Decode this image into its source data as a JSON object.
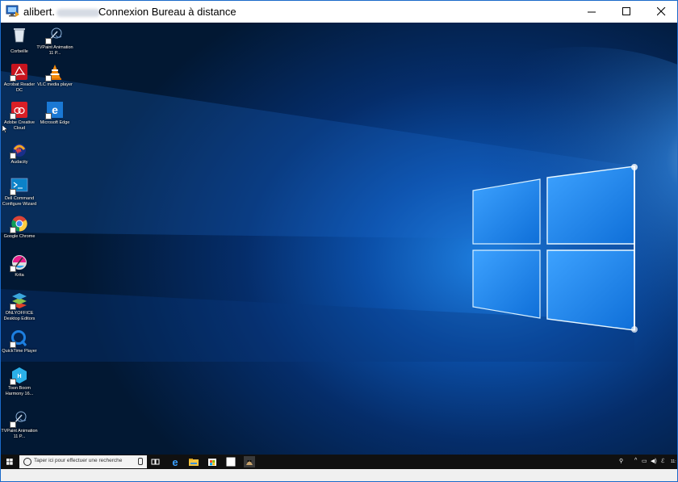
{
  "window": {
    "title_host": "alibert.",
    "title_app": "Connexion Bureau à distance",
    "controls": [
      "minimize",
      "maximize",
      "close"
    ]
  },
  "desktop_icons": [
    {
      "label": "Corbeille",
      "icon": "recycle-bin-icon"
    },
    {
      "label": "TVPaint Animation 11 P...",
      "icon": "tvpaint-icon"
    },
    {
      "label": "Acrobat Reader DC",
      "icon": "acrobat-icon"
    },
    {
      "label": "VLC media player",
      "icon": "vlc-icon"
    },
    {
      "label": "Adobe Creative Cloud",
      "icon": "creative-cloud-icon"
    },
    {
      "label": "Microsoft Edge",
      "icon": "edge-icon"
    },
    {
      "label": "Audacity",
      "icon": "audacity-icon"
    },
    {
      "label": "Dell Command Configure Wizard",
      "icon": "dell-command-icon"
    },
    {
      "label": "Google Chrome",
      "icon": "chrome-icon"
    },
    {
      "label": "Krita",
      "icon": "krita-icon"
    },
    {
      "label": "ONLYOFFICE Desktop Editors",
      "icon": "onlyoffice-icon"
    },
    {
      "label": "QuickTime Player",
      "icon": "quicktime-icon"
    },
    {
      "label": "Toon Boom Harmony 16...",
      "icon": "toonboom-icon"
    },
    {
      "label": "TVPaint Animation 11 P...",
      "icon": "tvpaint-icon"
    }
  ],
  "taskbar": {
    "search_placeholder": "Taper ici pour effectuer une recherche",
    "pinned": [
      "task-view-icon",
      "edge-icon",
      "file-explorer-icon",
      "store-icon",
      "blank-app-icon",
      "gimp-icon"
    ],
    "tray_clock": "11:"
  },
  "colors": {
    "accent": "#1b6ac9",
    "taskbar": "#101010",
    "wallpaper_blue": "#0b4fa8"
  }
}
